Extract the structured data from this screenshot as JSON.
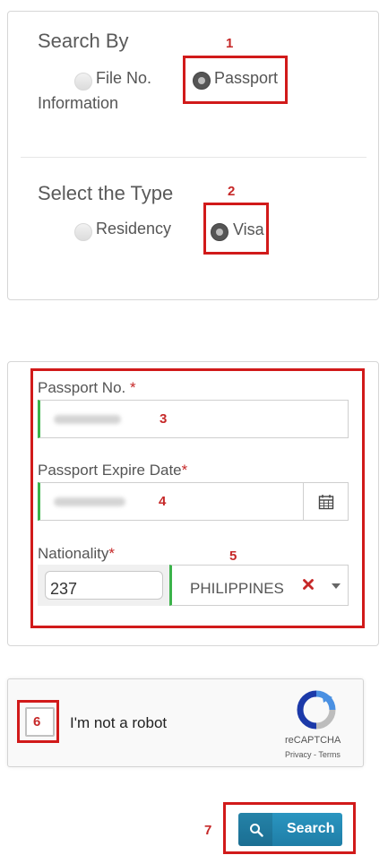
{
  "search_by": {
    "title": "Search By",
    "option_file": "File No.",
    "option_file_line2": "Information",
    "option_passport": "Passport",
    "selected": "Passport"
  },
  "select_type": {
    "title": "Select the Type",
    "option_residency": "Residency",
    "option_visa": "Visa",
    "selected": "Visa"
  },
  "form": {
    "passport_no_label": "Passport No.",
    "passport_expire_label": "Passport Expire Date",
    "nationality_label": "Nationality",
    "required_mark": "*",
    "nationality_code": "237",
    "nationality_value": "PHILIPPINES"
  },
  "captcha": {
    "label": "I'm not a robot",
    "brand": "reCAPTCHA",
    "links": "Privacy - Terms"
  },
  "search_button": {
    "label": "Search"
  },
  "annotations": [
    "1",
    "2",
    "3",
    "4",
    "5",
    "6",
    "7"
  ],
  "colors": {
    "annotation": "#d11a1a",
    "valid_field": "#3bb34a",
    "primary_button": "#2588b3",
    "required": "#c62828"
  },
  "icons": [
    "calendar-icon",
    "clear-x-icon",
    "dropdown-caret-icon",
    "recaptcha-logo-icon",
    "search-icon"
  ]
}
